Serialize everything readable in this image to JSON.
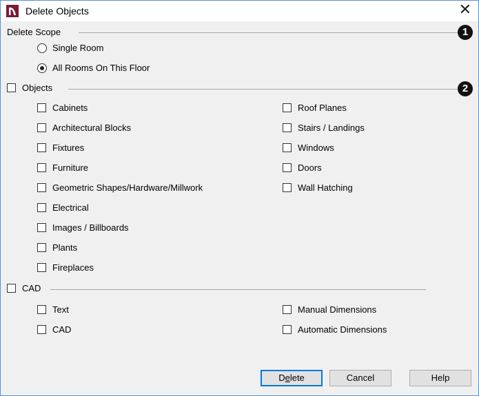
{
  "window": {
    "title": "Delete Objects",
    "close_glyph": "✕",
    "icon": "app-icon"
  },
  "scope": {
    "label": "Delete Scope",
    "marker": "1",
    "options": [
      {
        "label": "Single Room",
        "selected": false
      },
      {
        "label": "All Rooms On This Floor",
        "selected": true
      }
    ]
  },
  "objects": {
    "label": "Objects",
    "checked": false,
    "marker": "2",
    "left_items": [
      "Cabinets",
      "Architectural Blocks",
      "Fixtures",
      "Furniture",
      "Geometric Shapes/Hardware/Millwork",
      "Electrical",
      "Images / Billboards",
      "Plants",
      "Fireplaces"
    ],
    "right_items": [
      "Roof Planes",
      "Stairs / Landings",
      "Windows",
      "Doors",
      "Wall Hatching"
    ]
  },
  "cad": {
    "label": "CAD",
    "checked": false,
    "left_items": [
      "Text",
      "CAD"
    ],
    "right_items": [
      "Manual Dimensions",
      "Automatic Dimensions"
    ]
  },
  "buttons": {
    "delete_pre": "D",
    "delete_mnemonic": "e",
    "delete_post": "lete",
    "cancel": "Cancel",
    "help": "Help"
  }
}
